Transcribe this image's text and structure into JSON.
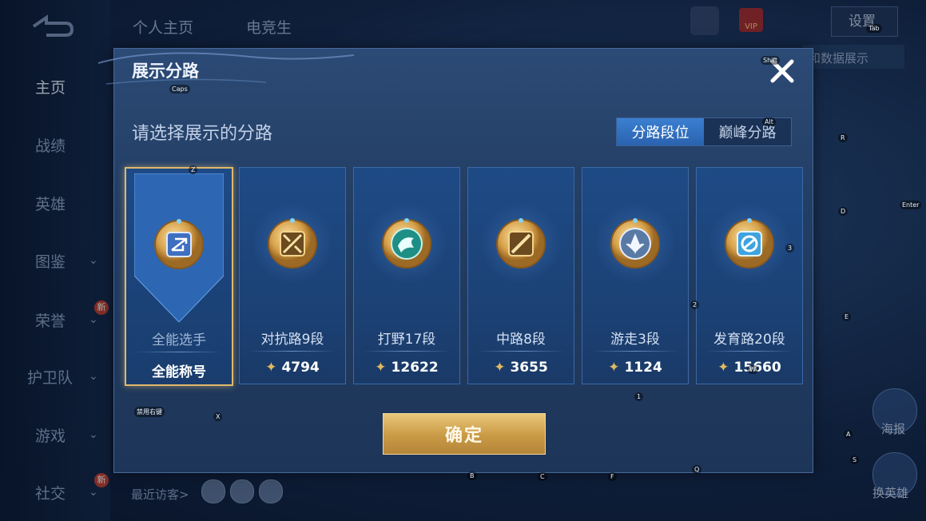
{
  "background": {
    "nav": [
      {
        "label": "主页",
        "active": true,
        "chevron": false,
        "badge": ""
      },
      {
        "label": "战绩",
        "active": false,
        "chevron": false,
        "badge": ""
      },
      {
        "label": "英雄",
        "active": false,
        "chevron": false,
        "badge": ""
      },
      {
        "label": "图鉴",
        "active": false,
        "chevron": true,
        "badge": ""
      },
      {
        "label": "荣誉",
        "active": false,
        "chevron": true,
        "badge": "新"
      },
      {
        "label": "护卫队",
        "active": false,
        "chevron": true,
        "badge": ""
      },
      {
        "label": "游戏",
        "active": false,
        "chevron": true,
        "badge": ""
      },
      {
        "label": "社交",
        "active": false,
        "chevron": true,
        "badge": "新"
      }
    ],
    "top_tabs": [
      "个人主页",
      "电竞生"
    ],
    "vip_label": "VIP",
    "settings_label": "设置",
    "banner_text": "和数据展示",
    "right_buttons": [
      "海报",
      "换英雄"
    ],
    "visitors_label": "最近访客>"
  },
  "modal": {
    "title": "展示分路",
    "subtitle": "请选择展示的分路",
    "segment": {
      "options": [
        "分路段位",
        "巅峰分路"
      ],
      "selected_index": 0
    },
    "cards": [
      {
        "role": "全能选手",
        "score": "全能称号",
        "selected": true,
        "emblem": "allround-emblem",
        "has_icon": false
      },
      {
        "role": "对抗路9段",
        "score": "4794",
        "selected": false,
        "emblem": "clash-lane-emblem",
        "has_icon": true
      },
      {
        "role": "打野17段",
        "score": "12622",
        "selected": false,
        "emblem": "jungle-emblem",
        "has_icon": true
      },
      {
        "role": "中路8段",
        "score": "3655",
        "selected": false,
        "emblem": "mid-lane-emblem",
        "has_icon": true
      },
      {
        "role": "游走3段",
        "score": "1124",
        "selected": false,
        "emblem": "roam-emblem",
        "has_icon": true
      },
      {
        "role": "发育路20段",
        "score": "15660",
        "selected": false,
        "emblem": "farm-lane-emblem",
        "has_icon": true
      }
    ],
    "confirm_label": "确定"
  },
  "key_hints": {
    "caps": "Caps",
    "shift": "Shift",
    "alt": "Alt",
    "tab": "Tab",
    "enter": "Enter",
    "z": "Z",
    "x": "X",
    "r": "R",
    "d": "D",
    "e": "E",
    "a": "A",
    "s": "S",
    "q": "Q",
    "b": "B",
    "c": "C",
    "f": "F",
    "w": "W",
    "n1": "1",
    "n2": "2",
    "n3": "3",
    "hint_text": "禁用右键"
  },
  "colors": {
    "accent_gold": "#e0b86a",
    "active_blue": "#2f6fc0",
    "modal_bg": "#223d63"
  }
}
